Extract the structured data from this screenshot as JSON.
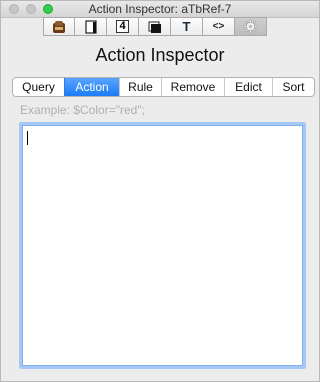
{
  "window": {
    "title": "Action Inspector: aTbRef-7"
  },
  "toolbar": {
    "buttons": [
      {
        "icon": "tag-icon"
      },
      {
        "icon": "page-icon"
      },
      {
        "icon": "quickstamp-4-icon",
        "label": "4"
      },
      {
        "icon": "stack-icon"
      },
      {
        "icon": "text-icon",
        "label": "T"
      },
      {
        "icon": "code-icon",
        "label": "<>"
      },
      {
        "icon": "gear-icon"
      }
    ],
    "active_index": 6
  },
  "heading": "Action Inspector",
  "tabs": [
    "Query",
    "Action",
    "Rule",
    "Remove",
    "Edict",
    "Sort"
  ],
  "selected_tab": "Action",
  "editor": {
    "placeholder": "Example: $Color=\"red\";",
    "value": ""
  },
  "colors": {
    "accent": "#1a7cf5",
    "focus_ring": "#a6c8f5",
    "zoom_button": "#35c94a"
  }
}
